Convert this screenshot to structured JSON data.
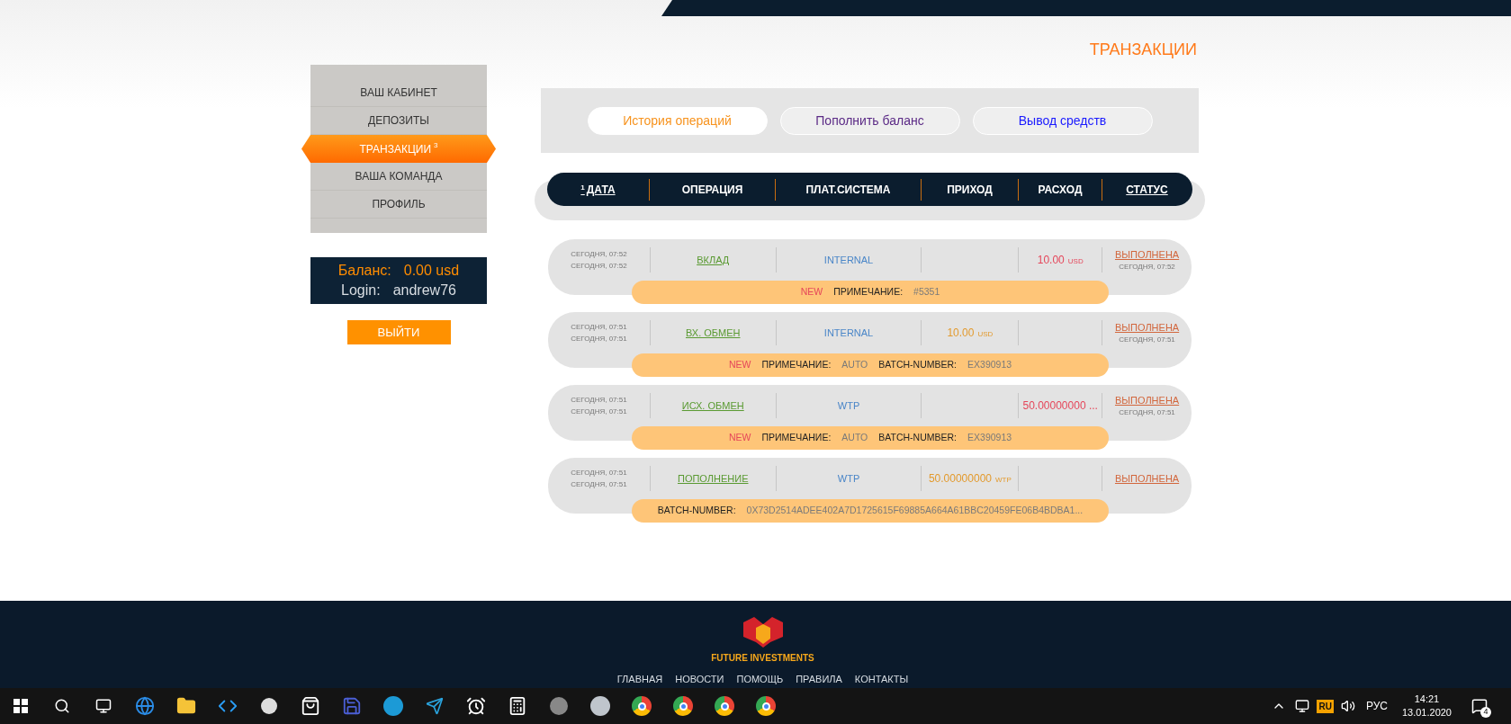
{
  "page_title": "ТРАНЗАКЦИИ",
  "sidebar": {
    "items": [
      {
        "label": "ВАШ КАБИНЕТ",
        "selected": false
      },
      {
        "label": "ДЕПОЗИТЫ",
        "selected": false
      },
      {
        "label": "ТРАНЗАКЦИИ",
        "badge": "3",
        "selected": true
      },
      {
        "label": "ВАША КОМАНДА",
        "selected": false
      },
      {
        "label": "ПРОФИЛЬ",
        "selected": false
      }
    ]
  },
  "account": {
    "balance_label": "Баланс:",
    "balance": "0.00 usd",
    "login_label": "Login:",
    "login": "andrew76"
  },
  "logout_button": "ВЫЙТИ",
  "tabs": [
    {
      "label": "История операций",
      "selected": true,
      "color": "#f7931e"
    },
    {
      "label": "Пополнить баланс",
      "selected": false,
      "color": "#5b2a86"
    },
    {
      "label": "Вывод средств",
      "selected": false,
      "color": "#1a1aff"
    }
  ],
  "table": {
    "columns": [
      {
        "label": "ДАТА",
        "badge": "1",
        "underlined": true
      },
      {
        "label": "ОПЕРАЦИЯ",
        "underlined": false
      },
      {
        "label": "ПЛАТ.СИСТЕМА",
        "underlined": false
      },
      {
        "label": "ПРИХОД",
        "underlined": false
      },
      {
        "label": "РАСХОД",
        "underlined": false
      },
      {
        "label": "СТАТУС",
        "underlined": true
      }
    ],
    "rows": [
      {
        "dates": [
          "СЕГОДНЯ, 07:52",
          "СЕГОДНЯ, 07:52"
        ],
        "operation": "ВКЛАД",
        "system": "INTERNAL",
        "income": null,
        "expense": {
          "amount": "10.00",
          "currency": "USD"
        },
        "status": "ВЫПОЛНЕНА",
        "status_time": "СЕГОДНЯ, 07:52",
        "note": [
          {
            "kind": "new",
            "text": "NEW"
          },
          {
            "kind": "label",
            "text": "ПРИМЕЧАНИЕ:"
          },
          {
            "kind": "value",
            "text": "#5351"
          }
        ]
      },
      {
        "dates": [
          "СЕГОДНЯ, 07:51",
          "СЕГОДНЯ, 07:51"
        ],
        "operation": "ВХ. ОБМЕН",
        "system": "INTERNAL",
        "income": {
          "amount": "10.00",
          "currency": "USD"
        },
        "expense": null,
        "status": "ВЫПОЛНЕНА",
        "status_time": "СЕГОДНЯ, 07:51",
        "note": [
          {
            "kind": "new",
            "text": "NEW"
          },
          {
            "kind": "label",
            "text": "ПРИМЕЧАНИЕ:"
          },
          {
            "kind": "value",
            "text": "AUTO"
          },
          {
            "kind": "label",
            "text": "BATCH-NUMBER:"
          },
          {
            "kind": "value",
            "text": "EX390913"
          }
        ]
      },
      {
        "dates": [
          "СЕГОДНЯ, 07:51",
          "СЕГОДНЯ, 07:51"
        ],
        "operation": "ИСХ. ОБМЕН",
        "system": "WTP",
        "income": null,
        "expense": {
          "amount": "50.00000000 ..."
        },
        "status": "ВЫПОЛНЕНА",
        "status_time": "СЕГОДНЯ, 07:51",
        "note": [
          {
            "kind": "new",
            "text": "NEW"
          },
          {
            "kind": "label",
            "text": "ПРИМЕЧАНИЕ:"
          },
          {
            "kind": "value",
            "text": "AUTO"
          },
          {
            "kind": "label",
            "text": "BATCH-NUMBER:"
          },
          {
            "kind": "value",
            "text": "EX390913"
          }
        ]
      },
      {
        "dates": [
          "СЕГОДНЯ, 07:51",
          "СЕГОДНЯ, 07:51"
        ],
        "operation": "ПОПОЛНЕНИЕ",
        "system": "WTP",
        "income": {
          "amount": "50.00000000",
          "currency": "WTP"
        },
        "expense": null,
        "status": "ВЫПОЛНЕНА",
        "note": [
          {
            "kind": "label",
            "text": "BATCH-NUMBER:"
          },
          {
            "kind": "value",
            "text": "0X73D2514ADEE402A7D1725615F69885A664A61BBC20459FE06B4BDBA1..."
          }
        ]
      }
    ]
  },
  "footer": {
    "brand": "FUTURE INVESTMENTS",
    "links": [
      "ГЛАВНАЯ",
      "НОВОСТИ",
      "ПОМОЩЬ",
      "ПРАВИЛА",
      "КОНТАКТЫ"
    ]
  },
  "tray": {
    "language": "RU",
    "input": "РУС",
    "time": "14:21",
    "date": "13.01.2020",
    "notifications": "4"
  }
}
